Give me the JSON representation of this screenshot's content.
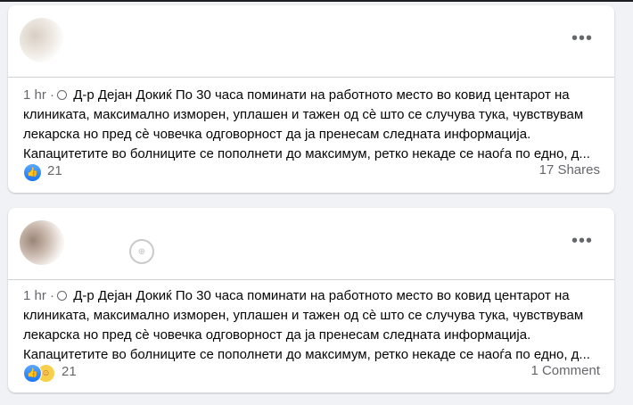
{
  "posts": [
    {
      "time": "1 hr",
      "separator": "·",
      "text_lines": [
        "Д-р Дејан Докиќ По 30 часа поминати на работното место во ковид центарот на",
        "клиниката, максимално изморен, уплашен и тажен од сѐ што се случува тука, чувствувам",
        "лекарска но пред сѐ човечка одговорност да ја пренесам следната информација.",
        "Капацитетите во болниците се пополнети до максимум, ретко некаде се наоѓа по едно, д..."
      ],
      "reactions_count": "21",
      "right_stat": "17 Shares"
    },
    {
      "time": "1 hr",
      "separator": "·",
      "text_lines": [
        "Д-р Дејан Докиќ По 30 часа поминати на работното место во ковид центарот на",
        "клиниката, максимално изморен, уплашен и тажен од сѐ што се случува тука, чувствувам",
        "лекарска но пред сѐ човечка одговорност да ја пренесам следната информација.",
        "Капацитетите во болниците се пополнети до максимум, ретко некаде се наоѓа по едно, д..."
      ],
      "reactions_count": "21",
      "right_stat": "1 Comment"
    }
  ],
  "icons": {
    "more": "more-options-icon",
    "globe": "globe-icon",
    "like": "like-reaction-icon",
    "haha": "haha-reaction-icon"
  },
  "colors": {
    "background": "#f0f2f5",
    "card": "#ffffff",
    "secondary_text": "#65676b",
    "like_blue": "#1877f2"
  }
}
